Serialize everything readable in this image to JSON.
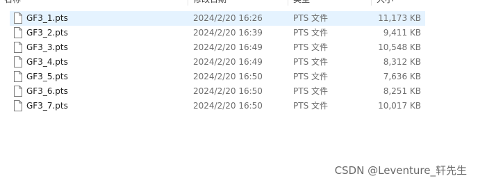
{
  "header": {
    "columns": [
      "名称",
      "修改日期",
      "类型",
      "大小"
    ]
  },
  "files": [
    {
      "name": "GF3_1.pts",
      "modified": "2024/2/20 16:26",
      "type": "PTS 文件",
      "size": "11,173 KB",
      "selected": true
    },
    {
      "name": "GF3_2.pts",
      "modified": "2024/2/20 16:39",
      "type": "PTS 文件",
      "size": "9,411 KB",
      "selected": false
    },
    {
      "name": "GF3_3.pts",
      "modified": "2024/2/20 16:49",
      "type": "PTS 文件",
      "size": "10,548 KB",
      "selected": false
    },
    {
      "name": "GF3_4.pts",
      "modified": "2024/2/20 16:49",
      "type": "PTS 文件",
      "size": "8,312 KB",
      "selected": false
    },
    {
      "name": "GF3_5.pts",
      "modified": "2024/2/20 16:50",
      "type": "PTS 文件",
      "size": "7,636 KB",
      "selected": false
    },
    {
      "name": "GF3_6.pts",
      "modified": "2024/2/20 16:50",
      "type": "PTS 文件",
      "size": "8,251 KB",
      "selected": false
    },
    {
      "name": "GF3_7.pts",
      "modified": "2024/2/20 16:50",
      "type": "PTS 文件",
      "size": "10,017 KB",
      "selected": false
    }
  ],
  "icons": {
    "file": "generic-file-icon"
  },
  "colors": {
    "selected_row": "#e5f3ff",
    "secondary_text": "#6d6d6d"
  },
  "watermark": "CSDN @Leventure_轩先生"
}
